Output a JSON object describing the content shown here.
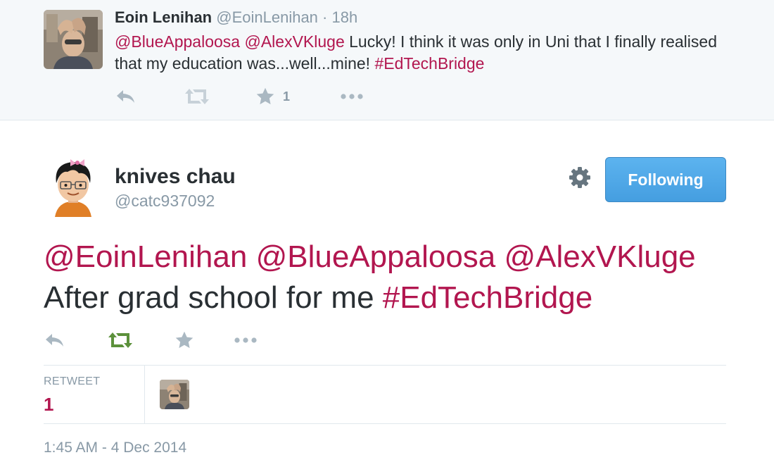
{
  "parent_tweet": {
    "name": "Eoin Lenihan",
    "handle": "@EoinLenihan",
    "time": "· 18h",
    "text": {
      "mention1": "@BlueAppaloosa",
      "mention2": "@AlexVKluge",
      "body": " Lucky! I think it was only in Uni that I finally realised that my education was...well...mine! ",
      "hashtag": "#EdTechBridge"
    },
    "actions": {
      "reply_icon": "reply-icon",
      "retweet_icon": "retweet-icon",
      "favorite_icon": "star-icon",
      "favorite_count": "1",
      "more_icon": "more-dots-icon"
    }
  },
  "main_tweet": {
    "name": "knives chau",
    "handle": "@catc937092",
    "follow_button": "Following",
    "text": {
      "mention1": "@EoinLenihan",
      "mention2": "@BlueAppaloosa",
      "mention3": "@AlexVKluge",
      "body": "After grad school for me ",
      "hashtag": "#EdTechBridge"
    },
    "stats": {
      "retweet_label": "RETWEET",
      "retweet_count": "1"
    },
    "timestamp": "1:45 AM - 4 Dec 2014"
  },
  "colors": {
    "link": "#b2164f",
    "muted": "#8899a6",
    "text": "#292f33",
    "retweeted": "#5c913b",
    "button": "#55acee",
    "panel": "#f5f8fa"
  }
}
